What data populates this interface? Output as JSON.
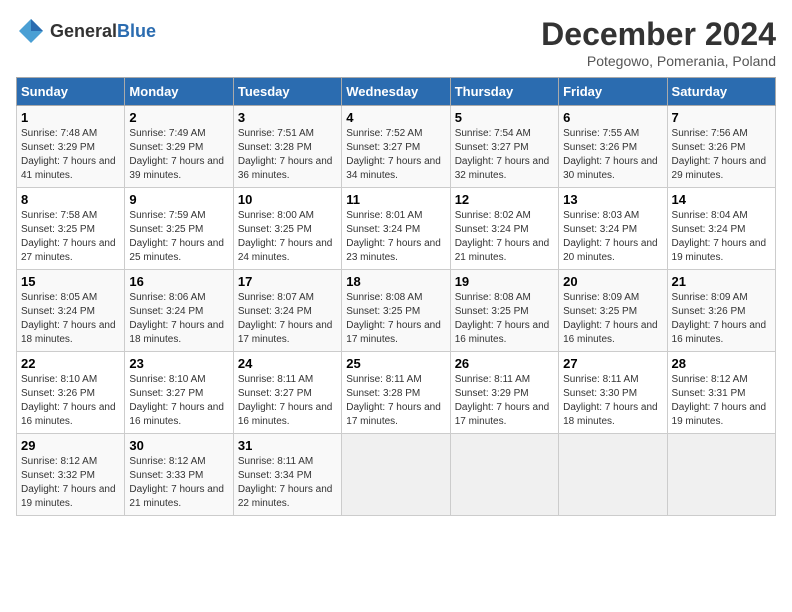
{
  "header": {
    "logo_general": "General",
    "logo_blue": "Blue",
    "month_title": "December 2024",
    "location": "Potegowo, Pomerania, Poland"
  },
  "days_of_week": [
    "Sunday",
    "Monday",
    "Tuesday",
    "Wednesday",
    "Thursday",
    "Friday",
    "Saturday"
  ],
  "weeks": [
    [
      {
        "day": "1",
        "sunrise": "7:48 AM",
        "sunset": "3:29 PM",
        "daylight": "7 hours and 41 minutes."
      },
      {
        "day": "2",
        "sunrise": "7:49 AM",
        "sunset": "3:29 PM",
        "daylight": "7 hours and 39 minutes."
      },
      {
        "day": "3",
        "sunrise": "7:51 AM",
        "sunset": "3:28 PM",
        "daylight": "7 hours and 36 minutes."
      },
      {
        "day": "4",
        "sunrise": "7:52 AM",
        "sunset": "3:27 PM",
        "daylight": "7 hours and 34 minutes."
      },
      {
        "day": "5",
        "sunrise": "7:54 AM",
        "sunset": "3:27 PM",
        "daylight": "7 hours and 32 minutes."
      },
      {
        "day": "6",
        "sunrise": "7:55 AM",
        "sunset": "3:26 PM",
        "daylight": "7 hours and 30 minutes."
      },
      {
        "day": "7",
        "sunrise": "7:56 AM",
        "sunset": "3:26 PM",
        "daylight": "7 hours and 29 minutes."
      }
    ],
    [
      {
        "day": "8",
        "sunrise": "7:58 AM",
        "sunset": "3:25 PM",
        "daylight": "7 hours and 27 minutes."
      },
      {
        "day": "9",
        "sunrise": "7:59 AM",
        "sunset": "3:25 PM",
        "daylight": "7 hours and 25 minutes."
      },
      {
        "day": "10",
        "sunrise": "8:00 AM",
        "sunset": "3:25 PM",
        "daylight": "7 hours and 24 minutes."
      },
      {
        "day": "11",
        "sunrise": "8:01 AM",
        "sunset": "3:24 PM",
        "daylight": "7 hours and 23 minutes."
      },
      {
        "day": "12",
        "sunrise": "8:02 AM",
        "sunset": "3:24 PM",
        "daylight": "7 hours and 21 minutes."
      },
      {
        "day": "13",
        "sunrise": "8:03 AM",
        "sunset": "3:24 PM",
        "daylight": "7 hours and 20 minutes."
      },
      {
        "day": "14",
        "sunrise": "8:04 AM",
        "sunset": "3:24 PM",
        "daylight": "7 hours and 19 minutes."
      }
    ],
    [
      {
        "day": "15",
        "sunrise": "8:05 AM",
        "sunset": "3:24 PM",
        "daylight": "7 hours and 18 minutes."
      },
      {
        "day": "16",
        "sunrise": "8:06 AM",
        "sunset": "3:24 PM",
        "daylight": "7 hours and 18 minutes."
      },
      {
        "day": "17",
        "sunrise": "8:07 AM",
        "sunset": "3:24 PM",
        "daylight": "7 hours and 17 minutes."
      },
      {
        "day": "18",
        "sunrise": "8:08 AM",
        "sunset": "3:25 PM",
        "daylight": "7 hours and 17 minutes."
      },
      {
        "day": "19",
        "sunrise": "8:08 AM",
        "sunset": "3:25 PM",
        "daylight": "7 hours and 16 minutes."
      },
      {
        "day": "20",
        "sunrise": "8:09 AM",
        "sunset": "3:25 PM",
        "daylight": "7 hours and 16 minutes."
      },
      {
        "day": "21",
        "sunrise": "8:09 AM",
        "sunset": "3:26 PM",
        "daylight": "7 hours and 16 minutes."
      }
    ],
    [
      {
        "day": "22",
        "sunrise": "8:10 AM",
        "sunset": "3:26 PM",
        "daylight": "7 hours and 16 minutes."
      },
      {
        "day": "23",
        "sunrise": "8:10 AM",
        "sunset": "3:27 PM",
        "daylight": "7 hours and 16 minutes."
      },
      {
        "day": "24",
        "sunrise": "8:11 AM",
        "sunset": "3:27 PM",
        "daylight": "7 hours and 16 minutes."
      },
      {
        "day": "25",
        "sunrise": "8:11 AM",
        "sunset": "3:28 PM",
        "daylight": "7 hours and 17 minutes."
      },
      {
        "day": "26",
        "sunrise": "8:11 AM",
        "sunset": "3:29 PM",
        "daylight": "7 hours and 17 minutes."
      },
      {
        "day": "27",
        "sunrise": "8:11 AM",
        "sunset": "3:30 PM",
        "daylight": "7 hours and 18 minutes."
      },
      {
        "day": "28",
        "sunrise": "8:12 AM",
        "sunset": "3:31 PM",
        "daylight": "7 hours and 19 minutes."
      }
    ],
    [
      {
        "day": "29",
        "sunrise": "8:12 AM",
        "sunset": "3:32 PM",
        "daylight": "7 hours and 19 minutes."
      },
      {
        "day": "30",
        "sunrise": "8:12 AM",
        "sunset": "3:33 PM",
        "daylight": "7 hours and 21 minutes."
      },
      {
        "day": "31",
        "sunrise": "8:11 AM",
        "sunset": "3:34 PM",
        "daylight": "7 hours and 22 minutes."
      },
      null,
      null,
      null,
      null
    ]
  ],
  "labels": {
    "sunrise": "Sunrise:",
    "sunset": "Sunset:",
    "daylight": "Daylight:"
  }
}
